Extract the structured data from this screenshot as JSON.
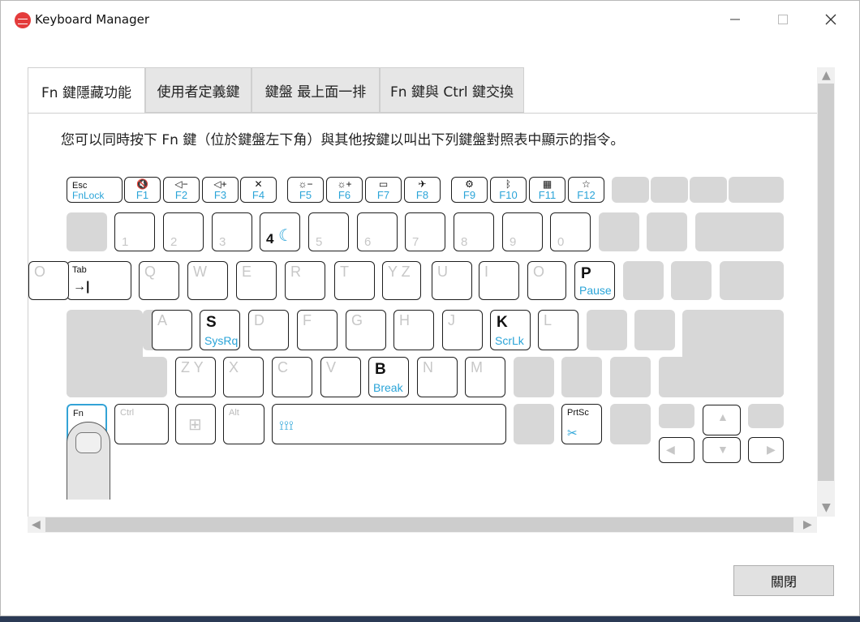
{
  "window": {
    "title": "Keyboard Manager"
  },
  "tabs": [
    {
      "label": "Fn 鍵隱藏功能"
    },
    {
      "label": "使用者定義鍵"
    },
    {
      "label": "鍵盤 最上面一排"
    },
    {
      "label": "Fn 鍵與 Ctrl 鍵交換"
    }
  ],
  "instruction": "您可以同時按下 Fn 鍵（位於鍵盤左下角）與其他按鍵以叫出下列鍵盤對照表中顯示的指令。",
  "keyboard": {
    "esc": {
      "top": "Esc",
      "bottom": "FnLock"
    },
    "fkeys": [
      {
        "icon": "🔇",
        "label": "F1"
      },
      {
        "icon": "◁−",
        "label": "F2"
      },
      {
        "icon": "◁+",
        "label": "F3"
      },
      {
        "icon": "✕",
        "label": "F4"
      },
      {
        "icon": "☼−",
        "label": "F5"
      },
      {
        "icon": "☼+",
        "label": "F6"
      },
      {
        "icon": "▭",
        "label": "F7"
      },
      {
        "icon": "✈",
        "label": "F8"
      },
      {
        "icon": "⚙",
        "label": "F9"
      },
      {
        "icon": "ᛒ",
        "label": "F10"
      },
      {
        "icon": "▦",
        "label": "F11"
      },
      {
        "icon": "☆",
        "label": "F12"
      }
    ],
    "numbers": [
      "1",
      "2",
      "3",
      "4",
      "5",
      "6",
      "7",
      "8",
      "9",
      "0"
    ],
    "qrow": [
      "Q",
      "W",
      "E",
      "R",
      "T",
      "Y Z",
      "U",
      "I",
      "O"
    ],
    "arow": [
      "A",
      "S",
      "D",
      "F",
      "G",
      "H",
      "J",
      "K",
      "L"
    ],
    "zrow": [
      "Z Y",
      "X",
      "C",
      "V",
      "B",
      "N",
      "M"
    ],
    "tab": "Tab",
    "fn": "Fn",
    "ctrl": "Ctrl",
    "alt": "Alt",
    "prtsc": "PrtSc",
    "sub": {
      "p": "Pause",
      "s": "SysRq",
      "k": "ScrLk",
      "b": "Break"
    }
  },
  "buttons": {
    "close": "關閉"
  }
}
